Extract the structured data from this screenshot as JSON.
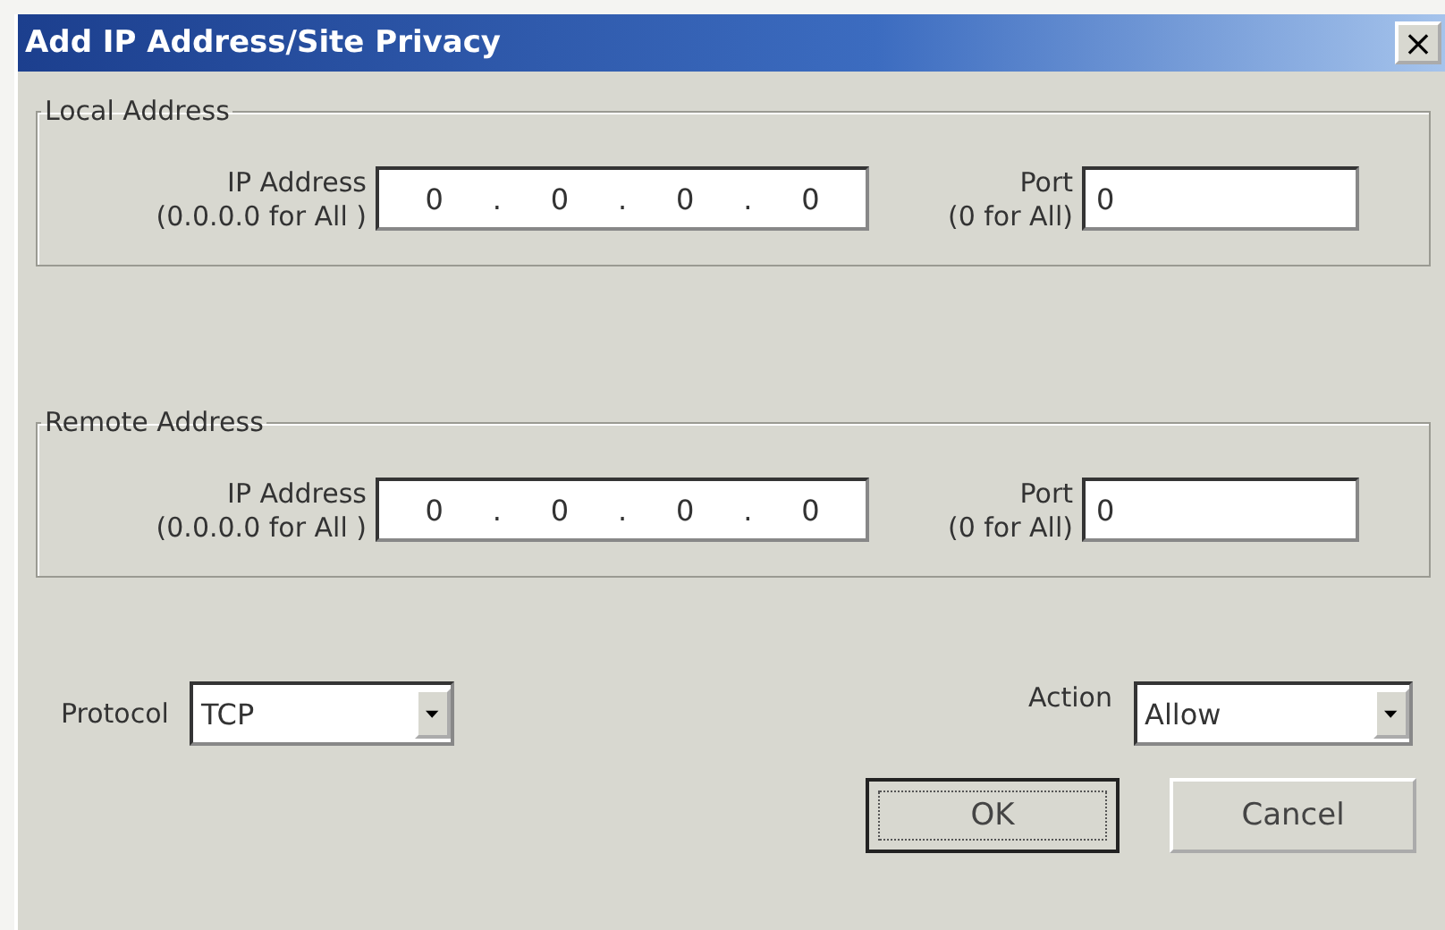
{
  "window": {
    "title": "Add IP Address/Site Privacy",
    "close": "×"
  },
  "groups": [
    {
      "title": "Local Address",
      "ip_label": "IP Address",
      "ip_hint": "(0.0.0.0 for All )",
      "octets": [
        "0",
        "0",
        "0",
        "0"
      ],
      "separators": [
        ".",
        ".",
        "."
      ],
      "port_label": "Port",
      "port_hint": "(0 for All)",
      "port": "0"
    },
    {
      "title": "Remote Address",
      "ip_label": "IP Address",
      "ip_hint": "(0.0.0.0 for All )",
      "octets": [
        "0",
        "0",
        "0",
        "0"
      ],
      "separators": [
        ".",
        ".",
        "."
      ],
      "port_label": "Port",
      "port_hint": "(0 for All)",
      "port": "0"
    }
  ],
  "protocol": {
    "label": "Protocol",
    "value": "TCP"
  },
  "action": {
    "label": "Action",
    "value": "Allow"
  },
  "buttons": [
    {
      "label": "OK",
      "focused": true
    },
    {
      "label": "Cancel",
      "focused": false
    }
  ]
}
